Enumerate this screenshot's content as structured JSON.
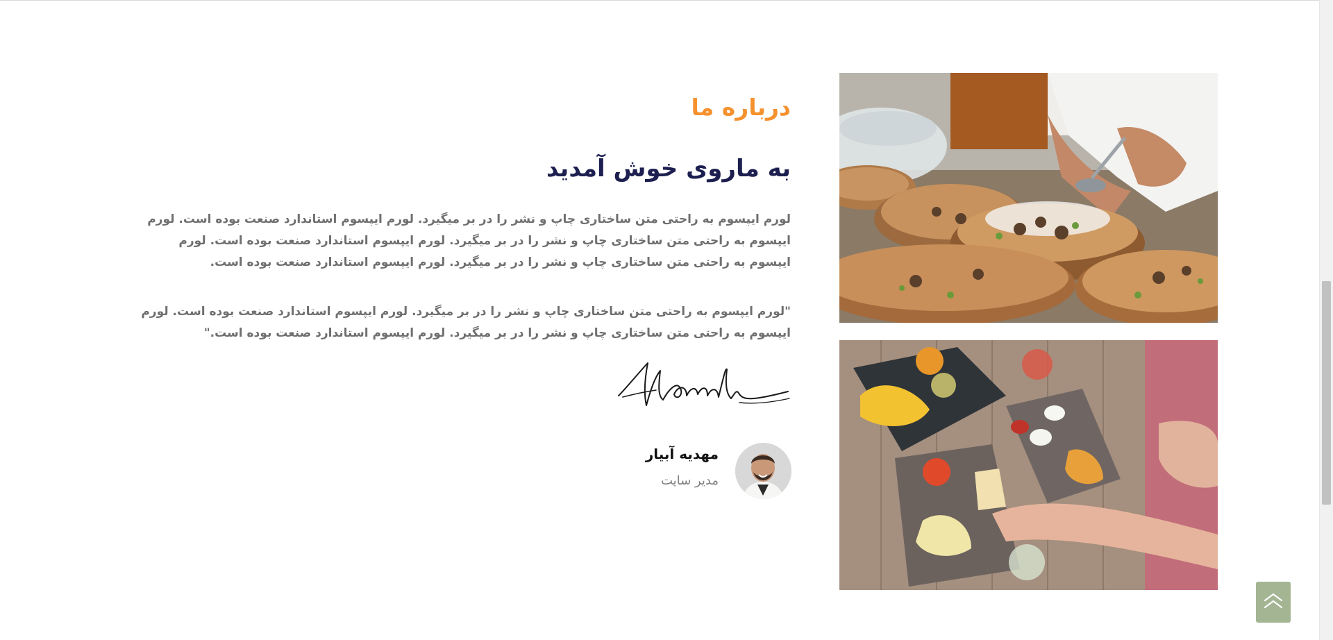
{
  "about": {
    "section_title": "درباره ما",
    "heading": "به ماروی خوش آمدید",
    "intro_paragraph": "لورم ایپسوم به راحتی متن ساختاری چاپ و نشر را در بر میگیرد. لورم ایپسوم استاندارد صنعت بوده است. لورم ایپسوم به راحتی متن ساختاری چاپ و نشر را در بر میگیرد. لورم ایپسوم استاندارد صنعت بوده است. لورم ایپسوم به راحتی متن ساختاری چاپ و نشر را در بر میگیرد. لورم ایپسوم استاندارد صنعت بوده است.",
    "quote_paragraph": "\"لورم ایپسوم به راحتی متن ساختاری چاپ و نشر را در بر میگیرد. لورم ایپسوم استاندارد صنعت بوده است. لورم ایپسوم به راحتی متن ساختاری چاپ و نشر را در بر میگیرد. لورم ایپسوم استاندارد صنعت بوده است.\""
  },
  "author": {
    "name": "مهدیه آبیار",
    "role": "مدیر سایت"
  },
  "images": {
    "top": "chef-plating-food-photo",
    "bottom": "shared-dishes-table-photo"
  },
  "icons": {
    "back_to_top": "double-chevron-up-icon"
  },
  "colors": {
    "accent": "#f5922f",
    "heading": "#1c1f4f",
    "body_text": "#6f6f6f",
    "back_to_top_bg": "#a3b592"
  }
}
